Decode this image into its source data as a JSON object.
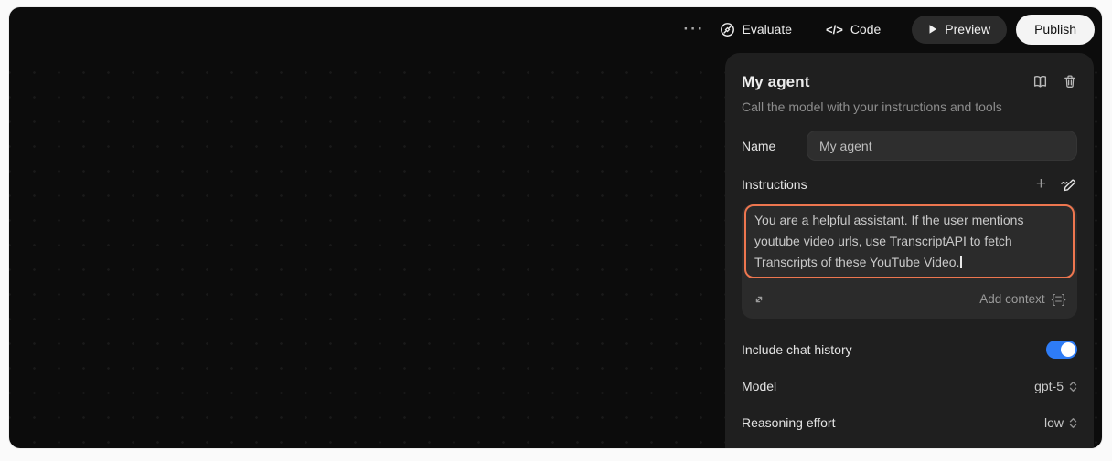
{
  "topbar": {
    "more_glyph": "···",
    "evaluate_label": "Evaluate",
    "code_glyph": "</>",
    "code_label": "Code",
    "preview_label": "Preview",
    "publish_label": "Publish"
  },
  "panel": {
    "title": "My agent",
    "subtitle": "Call the model with your instructions and tools",
    "name_field": {
      "label": "Name",
      "value": "My agent"
    },
    "instructions": {
      "label": "Instructions",
      "plus_glyph": "+",
      "lines": [
        "You are a helpful assistant. If the user mentions",
        "youtube video urls, use TranscriptAPI to fetch",
        "Transcripts of these YouTube Video."
      ],
      "add_context_label": "Add context",
      "add_context_glyph": "{≡}"
    },
    "settings": {
      "chat_history": {
        "label": "Include chat history",
        "state": "on"
      },
      "model": {
        "label": "Model",
        "value": "gpt-5"
      },
      "reasoning": {
        "label": "Reasoning effort",
        "value": "low"
      }
    }
  },
  "colors": {
    "selection_orange": "#ED764F",
    "toggle_blue": "#2E7CF6"
  }
}
